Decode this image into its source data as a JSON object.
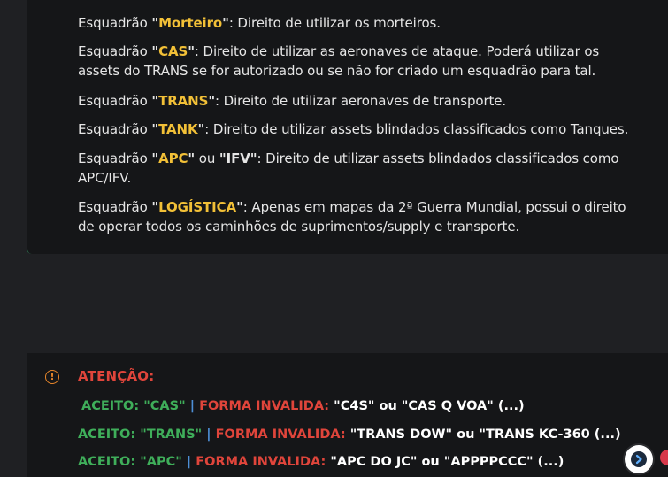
{
  "squads": [
    {
      "prefix": "Esquadrão ",
      "name": "Morteiro",
      "rest": ": Direito de utilizar os morteiros."
    },
    {
      "prefix": "Esquadrão ",
      "name": "CAS",
      "rest": ": Direito de utilizar as aeronaves de ataque. Poderá utilizar os assets do TRANS se for autorizado ou se não for criado um esquadrão para tal."
    },
    {
      "prefix": "Esquadrão ",
      "name": "TRANS",
      "rest": ": Direito de utilizar aeronaves de transporte."
    },
    {
      "prefix": "Esquadrão ",
      "name": "TANK",
      "rest": ": Direito de utilizar assets blindados classificados como Tanques."
    },
    {
      "prefix": "Esquadrão ",
      "name": "APC",
      "middle": " ou ",
      "name2": "IFV",
      "rest": ": Direito de utilizar assets blindados classificados como APC/IFV."
    },
    {
      "prefix": "Esquadrão ",
      "name": "LOGÍSTICA",
      "rest": ": Apenas em mapas da 2ª Guerra Mundial, possui o direito de operar todos os caminhões de suprimentos/supply e transporte."
    }
  ],
  "warning": {
    "icon": "exclamation-circle-icon",
    "title": "ATENÇÃO:",
    "lines": [
      {
        "accepted": "ACEITO: \"CAS\"",
        "sep": " | ",
        "invalid_label": "FORMA INVALIDA:",
        "examples": " \"C4S\" ou \"CAS Q VOA\" (...)"
      },
      {
        "accepted": "ACEITO: \"TRANS\"",
        "sep": " | ",
        "invalid_label": "FORMA INVALIDA:",
        "examples": " \"TRANS DOW\" ou \"TRANS KC-360 (...)"
      },
      {
        "accepted": "ACEITO: \"APC\"",
        "sep": " | ",
        "invalid_label": "FORMA INVALIDA:",
        "examples": " \"APC DO JC\" ou \"APPPPCCC\" (...)"
      }
    ]
  },
  "floating_button": {
    "icon": "chevron-right-icon"
  },
  "colors": {
    "highlight": "#f2c037",
    "accepted": "#3fae5a",
    "invalid": "#e0453b",
    "separator": "#4d8fd6",
    "warning_accent": "#e8862a"
  }
}
